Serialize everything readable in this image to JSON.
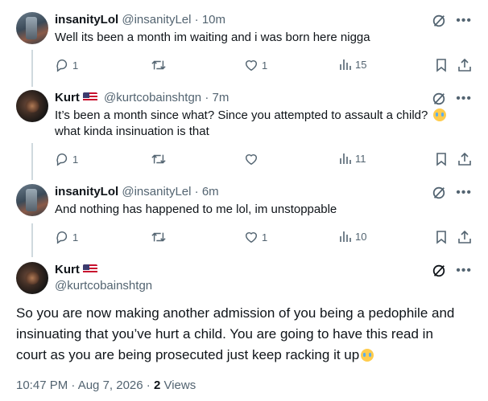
{
  "posts": [
    {
      "name": "insanityLol",
      "handle": "@insanityLel",
      "time": "10m",
      "text": "Well its been a month im waiting and i was born here nigga",
      "replies": "1",
      "reposts": "",
      "likes": "1",
      "views": "15"
    },
    {
      "name": "Kurt",
      "handle": "@kurtcobainshtgn",
      "time": "7m",
      "text_line1": "It’s been a month since what? Since you attempted to assault a child?",
      "text_line2": "what kinda insinuation is that",
      "replies": "1",
      "reposts": "",
      "likes": "",
      "views": "11"
    },
    {
      "name": "insanityLol",
      "handle": "@insanityLel",
      "time": "6m",
      "text": "And nothing has happened to me lol, im unstoppable",
      "replies": "1",
      "reposts": "",
      "likes": "1",
      "views": "10"
    }
  ],
  "focus": {
    "name": "Kurt",
    "handle": "@kurtcobainshtgn",
    "lines": [
      "So you are now making another admission of you being a pedophile and",
      "insinuating that you’ve hurt a child. You are going to have this read in",
      "court as you are being prosecuted just keep racking it up"
    ],
    "timestamp": "10:47 PM · Aug 7, 2026 ·",
    "views_count": "2",
    "views_label": "Views"
  },
  "dot": "·",
  "more": "•••",
  "icons": {
    "reply": "reply-icon",
    "repost": "repost-icon",
    "like": "heart-icon",
    "views": "views-icon",
    "bookmark": "bookmark-icon",
    "share": "share-icon",
    "grok": "slash-circle-icon",
    "more": "more-icon"
  },
  "colors": {
    "text": "#0f1419",
    "secondary": "#536471",
    "line": "#cfd9de"
  }
}
